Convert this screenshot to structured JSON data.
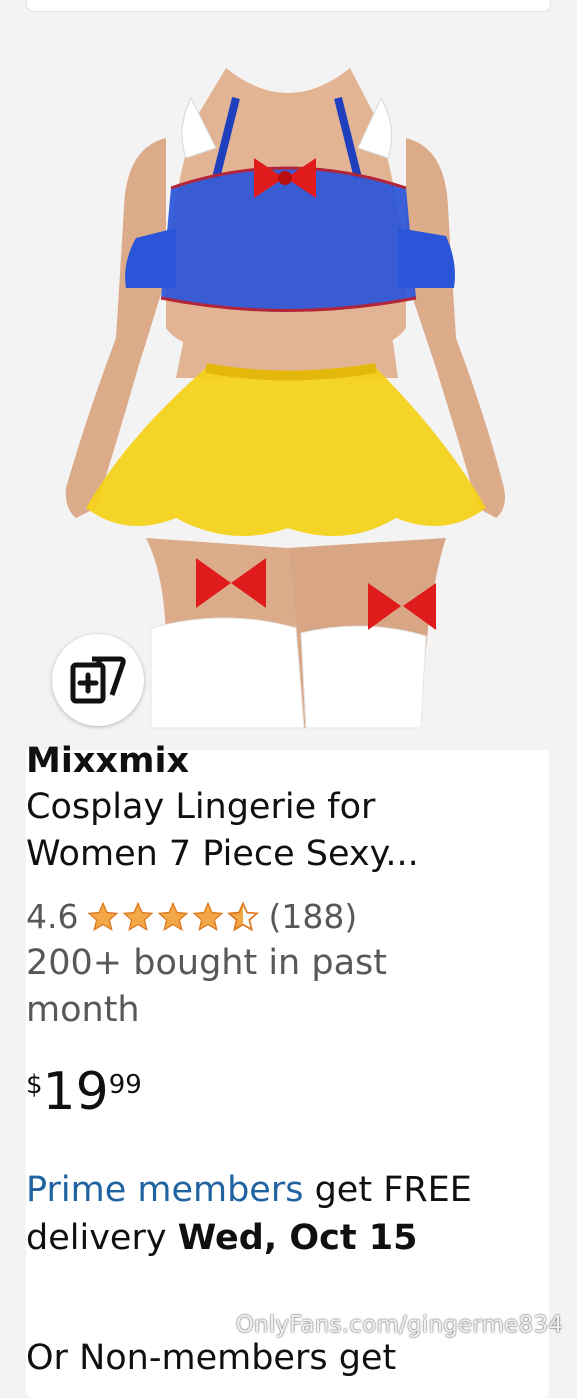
{
  "product": {
    "brand": "Mixxmix",
    "title_line1": "Cosplay Lingerie for",
    "title_line2": "Women 7 Piece Sexy...",
    "rating": "4.6",
    "stars_filled": 4.5,
    "review_count": "(188)",
    "bought_line1": "200+ bought in past",
    "bought_line2": "month",
    "price": {
      "currency": "$",
      "whole": "19",
      "fraction": "99"
    },
    "delivery": {
      "prime_label": "Prime members",
      "text1": " get FREE",
      "text2": "delivery ",
      "date": "Wed, Oct 15"
    },
    "cutoff_text": "Or Non-members get"
  },
  "icons": {
    "add_to_list": "add-to-list-icon",
    "star": "star-icon"
  },
  "watermark": "OnlyFans.com/gingerme834",
  "colors": {
    "star": "#f3a847",
    "star_outline": "#de7921",
    "prime_link": "#2162a1",
    "muted_text": "#565959"
  }
}
